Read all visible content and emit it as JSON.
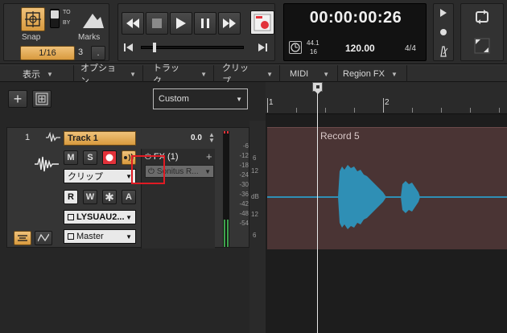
{
  "snap": {
    "label": "Snap",
    "value": "1/16",
    "count": "3",
    "dot": ".",
    "to": "TO",
    "by": "BY",
    "marks_label": "Marks"
  },
  "time": {
    "display": "00:00:00:26",
    "sample_rate_top": "44.1",
    "sample_rate_bottom": "16",
    "tempo": "120.00",
    "signature": "4/4"
  },
  "menus": [
    "表示",
    "オプション",
    "トラック",
    "クリップ",
    "MIDI",
    "Region FX"
  ],
  "toolbar": {
    "custom_select": "Custom"
  },
  "ruler": {
    "marks": [
      "1",
      "2"
    ]
  },
  "track": {
    "number": "1",
    "name": "Track 1",
    "volume": "0.0",
    "m": "M",
    "s": "S",
    "r": "R",
    "w": "W",
    "a": "A",
    "fx_label": "FX (1)",
    "fx_plugin": "Sonitus R...",
    "clip_mode": "クリップ",
    "input": "LYSUAU2...",
    "output": "Master",
    "meter_ticks": [
      "-6",
      "-12",
      "-18",
      "-24",
      "-30",
      "-36",
      "-42",
      "-48",
      "-54"
    ],
    "pan_ticks": [
      "6",
      "12",
      "dB",
      "12",
      "6"
    ]
  },
  "region": {
    "title": "Record 5"
  },
  "colors": {
    "accent": "#f0c27a",
    "record": "#e2323a",
    "waveform": "#2f8fb5",
    "highlight": "#e01b24"
  }
}
